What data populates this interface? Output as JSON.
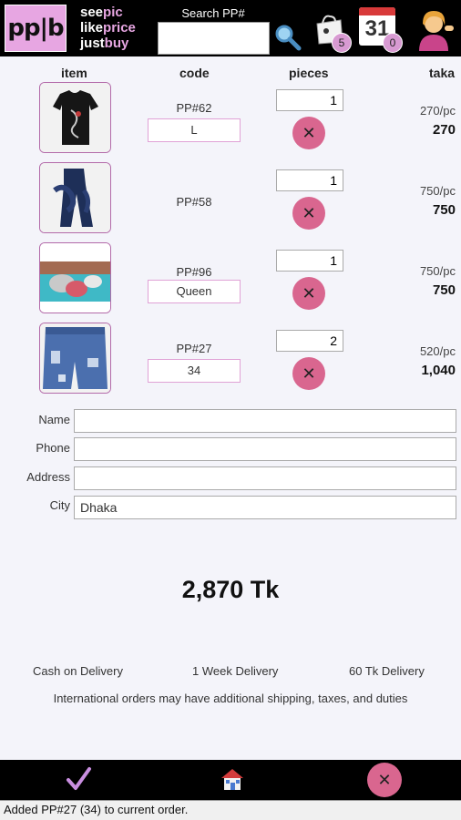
{
  "header": {
    "logo_text": "pp|b",
    "tagline": {
      "line1_a": "see",
      "line1_b": "pic",
      "line2_a": "like",
      "line2_b": "price",
      "line3_a": "just",
      "line3_b": "buy"
    },
    "search_label": "Search PP#",
    "search_value": "",
    "bag_count": "5",
    "calendar_day": "31",
    "calendar_count": "0"
  },
  "columns": {
    "item": "item",
    "code": "code",
    "pieces": "pieces",
    "taka": "taka"
  },
  "items": [
    {
      "code": "PP#62",
      "size": "L",
      "pieces": "1",
      "unit_price": "270/pc",
      "total": "270"
    },
    {
      "code": "PP#58",
      "size": "",
      "pieces": "1",
      "unit_price": "750/pc",
      "total": "750"
    },
    {
      "code": "PP#96",
      "size": "Queen",
      "pieces": "1",
      "unit_price": "750/pc",
      "total": "750"
    },
    {
      "code": "PP#27",
      "size": "34",
      "pieces": "2",
      "unit_price": "520/pc",
      "total": "1,040"
    }
  ],
  "form": {
    "name_label": "Name",
    "name_value": "",
    "phone_label": "Phone",
    "phone_value": "",
    "address_label": "Address",
    "address_value": "",
    "city_label": "City",
    "city_value": "Dhaka"
  },
  "grand_total": "2,870 Tk",
  "terms": {
    "payment": "Cash on Delivery",
    "delivery_time": "1 Week Delivery",
    "delivery_fee": "60 Tk Delivery",
    "note": "International orders may have additional shipping, taxes, and duties"
  },
  "status": "Added PP#27 (34) to current order."
}
